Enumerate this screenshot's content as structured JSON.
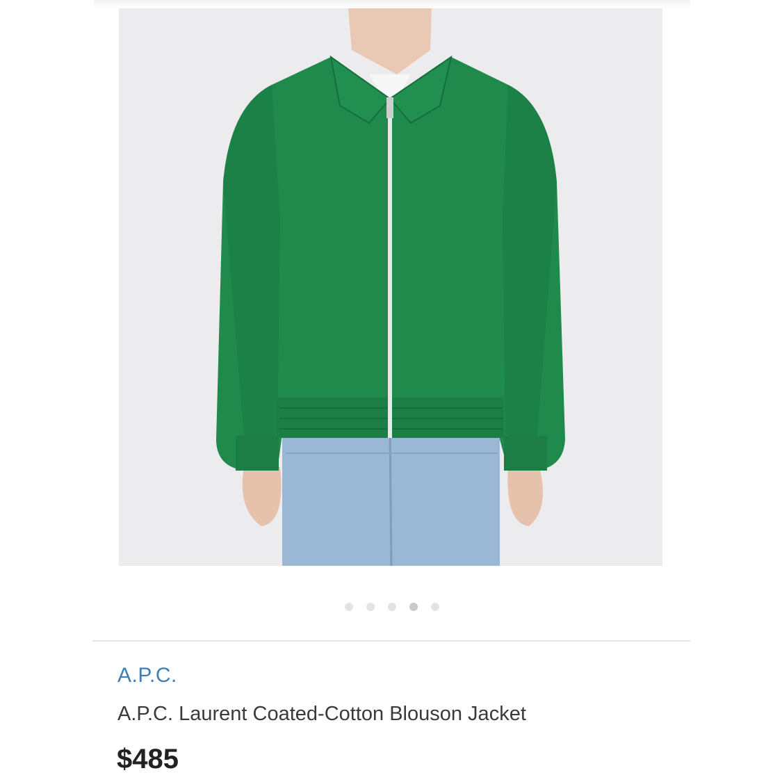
{
  "product": {
    "brand": "A.P.C.",
    "name": "A.P.C. Laurent Coated-Cotton Blouson Jacket",
    "price": "$485"
  },
  "gallery": {
    "image_description_icon": "green-jacket-photo",
    "dot_count": 5,
    "active_dot_index": 3
  },
  "colors": {
    "brand_link": "#3d7fb6",
    "jacket": "#1f8a4c",
    "jeans": "#9ab8d6"
  }
}
